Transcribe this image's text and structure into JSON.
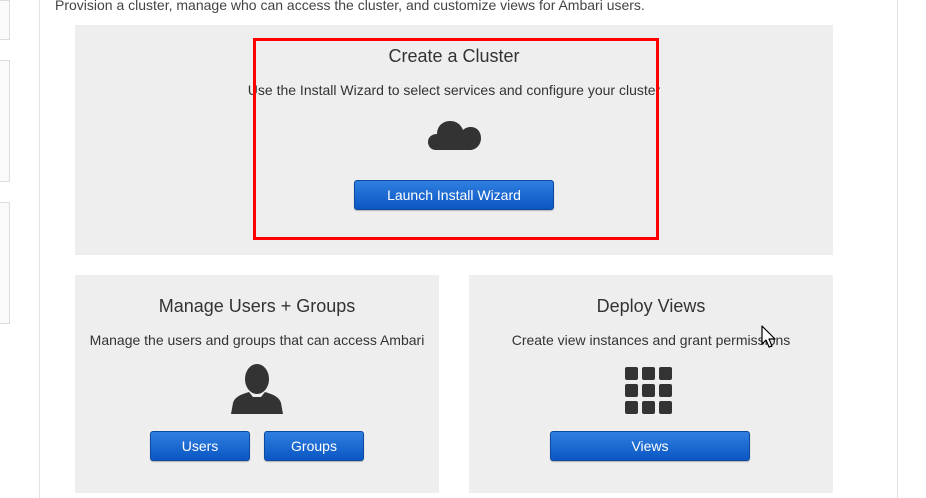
{
  "intro_text": "Provision a cluster, manage who can access the cluster, and customize views for Ambari users.",
  "create_cluster": {
    "title": "Create a Cluster",
    "description": "Use the Install Wizard to select services and configure your cluster",
    "icon": "cloud-icon",
    "button_label": "Launch Install Wizard"
  },
  "manage_users": {
    "title": "Manage Users + Groups",
    "description": "Manage the users and groups that can access Ambari",
    "icon": "user-icon",
    "users_button_label": "Users",
    "groups_button_label": "Groups"
  },
  "deploy_views": {
    "title": "Deploy Views",
    "description": "Create view instances and grant permissions",
    "icon": "grid-icon",
    "button_label": "Views"
  },
  "colors": {
    "panel_bg": "#eeeeee",
    "button_blue": "#0b56c4",
    "highlight": "#ff0000"
  }
}
